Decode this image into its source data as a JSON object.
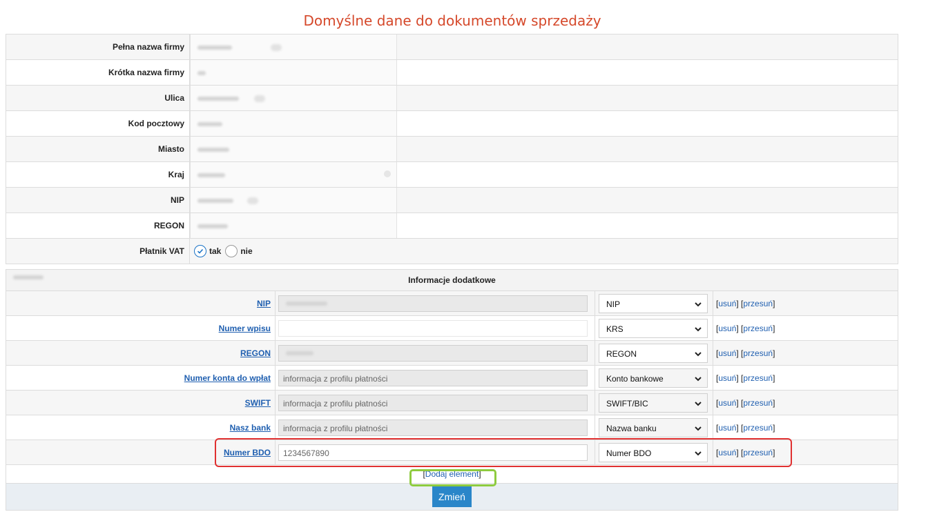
{
  "title": "Domyślne dane do dokumentów sprzedaży",
  "fields": [
    {
      "label": "Pełna nazwa firmy"
    },
    {
      "label": "Krótka nazwa firmy"
    },
    {
      "label": "Ulica"
    },
    {
      "label": "Kod pocztowy"
    },
    {
      "label": "Miasto"
    },
    {
      "label": "Kraj"
    },
    {
      "label": "NIP"
    },
    {
      "label": "REGON"
    }
  ],
  "vat": {
    "label": "Płatnik VAT",
    "yes": "tak",
    "no": "nie",
    "selected": "tak"
  },
  "extra_header": "Informacje dodatkowe",
  "extra": [
    {
      "label": "NIP",
      "value": "",
      "select": "NIP"
    },
    {
      "label": "Numer wpisu",
      "value": "",
      "select": "KRS"
    },
    {
      "label": "REGON",
      "value": "",
      "select": "REGON"
    },
    {
      "label": "Numer konta do wpłat",
      "value": "informacja z profilu płatności",
      "select": "Konto bankowe"
    },
    {
      "label": "SWIFT",
      "value": "informacja z profilu płatności",
      "select": "SWIFT/BIC"
    },
    {
      "label": "Nasz bank",
      "value": "informacja z profilu płatności",
      "select": "Nazwa banku"
    },
    {
      "label": "Numer BDO",
      "value": "1234567890",
      "select": "Numer BDO"
    }
  ],
  "actions": {
    "delete": "usuń",
    "move": "przesuń"
  },
  "add_element": "Dodaj element",
  "submit": "Zmień",
  "colors": {
    "title": "#d5482a",
    "link": "#1f5fb0",
    "button": "#2a86c9",
    "highlight_red": "#e03030",
    "highlight_green": "#8ecb3f"
  }
}
